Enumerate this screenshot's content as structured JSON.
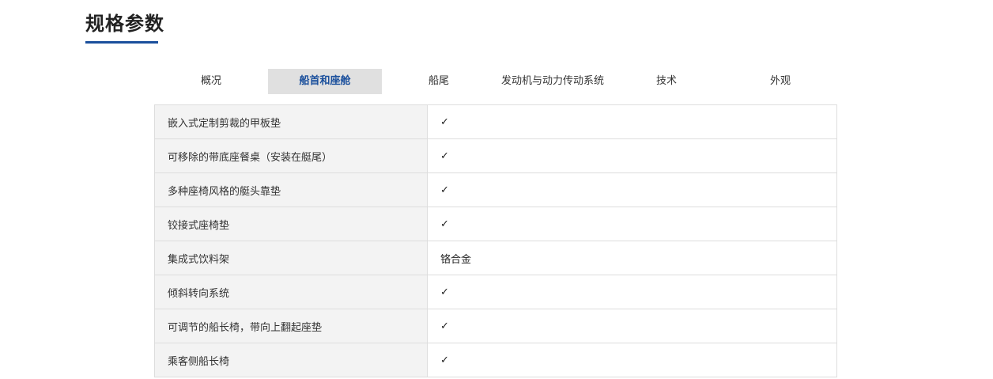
{
  "section": {
    "title": "规格参数"
  },
  "tabs": [
    {
      "label": "概况",
      "active": false
    },
    {
      "label": "船首和座舱",
      "active": true
    },
    {
      "label": "船尾",
      "active": false
    },
    {
      "label": "发动机与动力传动系统",
      "active": false
    },
    {
      "label": "技术",
      "active": false
    },
    {
      "label": "外观",
      "active": false
    }
  ],
  "specs": [
    {
      "label": "嵌入式定制剪裁的甲板垫",
      "value": "✓"
    },
    {
      "label": "可移除的带底座餐桌（安装在艇尾）",
      "value": "✓"
    },
    {
      "label": "多种座椅风格的艇头靠垫",
      "value": "✓"
    },
    {
      "label": "铰接式座椅垫",
      "value": "✓"
    },
    {
      "label": "集成式饮料架",
      "value": "铬合金"
    },
    {
      "label": "倾斜转向系统",
      "value": "✓"
    },
    {
      "label": "可调节的船长椅，带向上翻起座垫",
      "value": "✓"
    },
    {
      "label": "乘客侧船长椅",
      "value": "✓"
    }
  ],
  "colors": {
    "accent": "#1a4f9c",
    "active_tab_bg": "#e0e0e0",
    "label_bg": "#f3f3f3",
    "border": "#dddddd"
  }
}
